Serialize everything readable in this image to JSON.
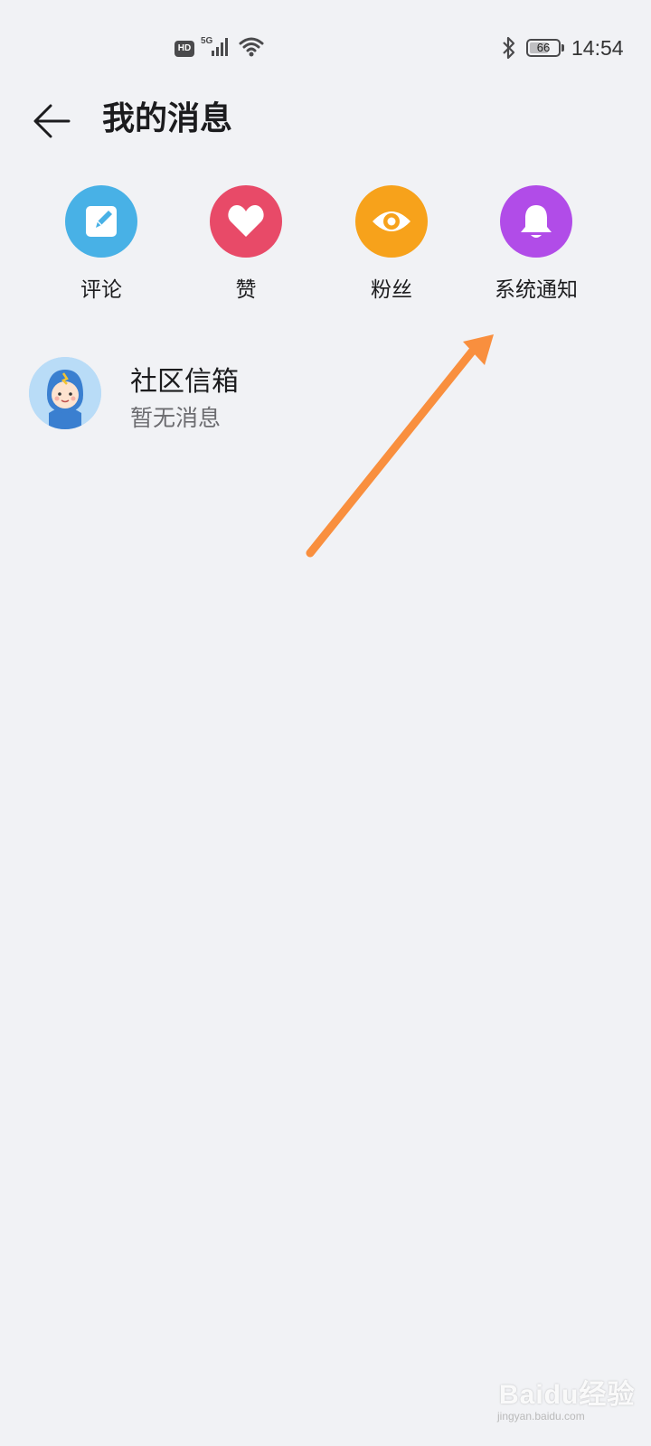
{
  "status_bar": {
    "hd": "HD",
    "network": "5G",
    "battery_level": 66,
    "battery_text": "66",
    "time": "14:54",
    "icons": [
      "signal-icon",
      "wifi-icon",
      "bluetooth-icon",
      "battery-icon"
    ]
  },
  "header": {
    "back_icon": "arrow-left-icon",
    "title": "我的消息"
  },
  "categories": [
    {
      "label": "评论",
      "icon": "edit-icon",
      "color": "#48b1e6"
    },
    {
      "label": "赞",
      "icon": "heart-icon",
      "color": "#e84a68"
    },
    {
      "label": "粉丝",
      "icon": "eye-icon",
      "color": "#f7a21b"
    },
    {
      "label": "系统通知",
      "icon": "bell-icon",
      "color": "#b14ce8"
    }
  ],
  "mailbox": {
    "title": "社区信箱",
    "subtitle": "暂无消息",
    "avatar_icon": "avatar-icon"
  },
  "annotation": {
    "arrow_color": "#f98f3e"
  },
  "watermark": {
    "main": "Baidu经验",
    "sub": "jingyan.baidu.com"
  }
}
